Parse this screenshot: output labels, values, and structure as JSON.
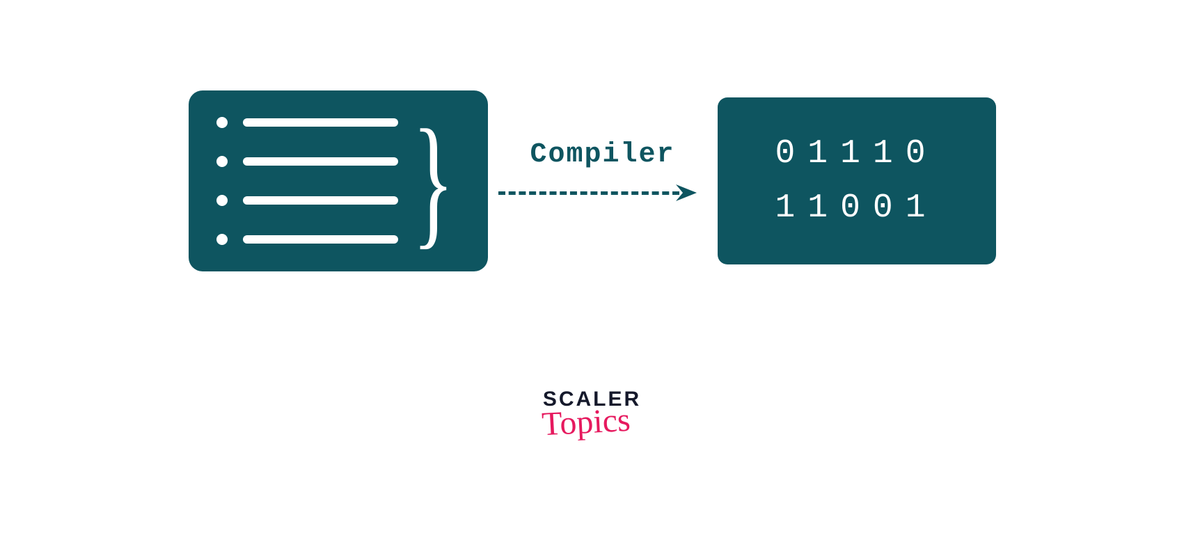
{
  "diagram": {
    "arrow_label": "Compiler",
    "binary_lines": [
      "01110",
      "11001"
    ],
    "source_lines": 4,
    "colors": {
      "box_bg": "#0e5560",
      "box_fg": "#ffffff",
      "accent": "#e6195e",
      "logo_dark": "#15192b"
    }
  },
  "branding": {
    "main": "SCALER",
    "sub": "Topics"
  }
}
